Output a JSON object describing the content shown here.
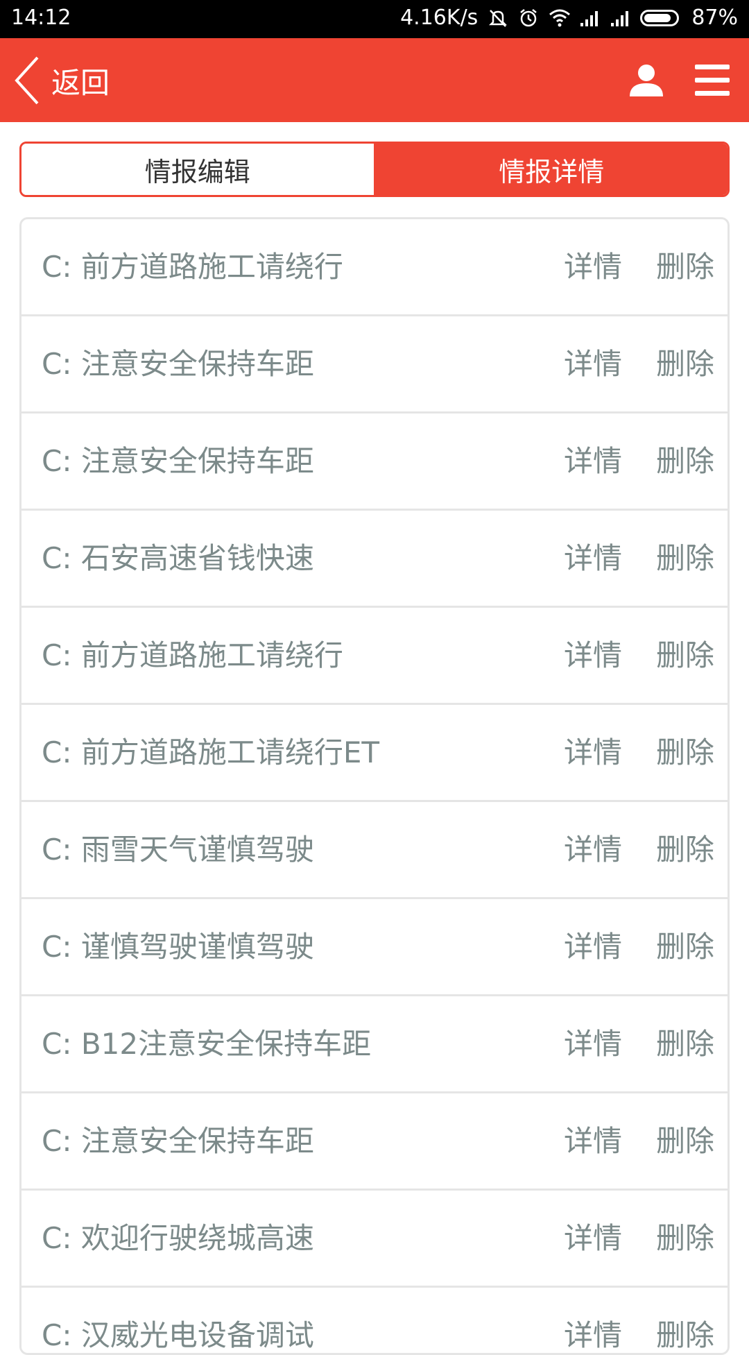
{
  "status_bar": {
    "time": "14:12",
    "net_speed": "4.16K/s",
    "battery_text": "87%",
    "battery_level": 0.87,
    "icons": [
      "mute-icon",
      "alarm-icon",
      "wifi-icon",
      "signal-icon",
      "signal-icon",
      "battery-icon"
    ]
  },
  "app_bar": {
    "back_label": "返回",
    "icons": [
      "chevron-left-icon",
      "user-icon",
      "menu-icon"
    ],
    "color": "#ef4433"
  },
  "tabs": [
    {
      "label": "情报编辑",
      "active": false
    },
    {
      "label": "情报详情",
      "active": true
    }
  ],
  "list": {
    "detail_label": "详情",
    "delete_label": "删除",
    "items": [
      {
        "text": "C: 前方道路施工请绕行"
      },
      {
        "text": "C: 注意安全保持车距"
      },
      {
        "text": "C: 注意安全保持车距"
      },
      {
        "text": "C: 石安高速省钱快速"
      },
      {
        "text": "C: 前方道路施工请绕行"
      },
      {
        "text": "C: 前方道路施工请绕行ET"
      },
      {
        "text": "C: 雨雪天气谨慎驾驶"
      },
      {
        "text": "C: 谨慎驾驶谨慎驾驶"
      },
      {
        "text": "C: B12注意安全保持车距"
      },
      {
        "text": "C: 注意安全保持车距"
      },
      {
        "text": "C: 欢迎行驶绕城高速"
      },
      {
        "text": "C: 汉威光电设备调试"
      }
    ]
  }
}
